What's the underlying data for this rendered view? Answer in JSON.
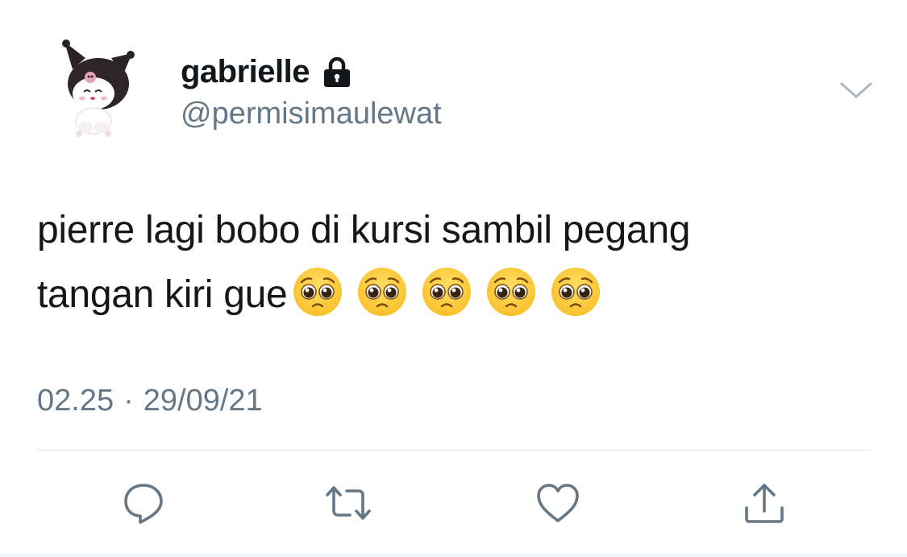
{
  "user": {
    "display_name": "gabrielle",
    "handle": "@permisimaulewat",
    "protected_icon": "lock-icon",
    "avatar": "kuromi-avatar"
  },
  "tweet": {
    "line1": "pierre lagi bobo di kursi sambil pegang",
    "line2": "tangan kiri gue",
    "emoji": [
      "🥺",
      "🥺",
      "🥺",
      "🥺",
      "🥺"
    ]
  },
  "meta": {
    "time": "02.25",
    "separator": "·",
    "date": "29/09/21"
  },
  "actions": [
    {
      "name": "reply",
      "icon": "reply-icon"
    },
    {
      "name": "retweet",
      "icon": "retweet-icon"
    },
    {
      "name": "like",
      "icon": "heart-icon"
    },
    {
      "name": "share",
      "icon": "share-icon"
    }
  ],
  "colors": {
    "text": "#14171a",
    "secondary": "#657786",
    "divider": "#e1e8ed",
    "emoji_face": "#f9c02a"
  }
}
